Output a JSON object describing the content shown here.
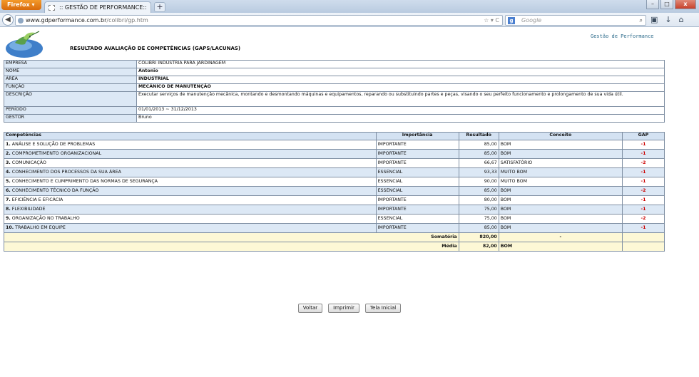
{
  "browser": {
    "app_button": "Firefox",
    "tab_title": ":: GESTÃO DE PERFORMANCE::",
    "new_tab": "+",
    "url_domain": "www.gdperformance.com.br",
    "url_path": "/colibri/gp.htm",
    "search_engine": "Google",
    "search_placeholder": "Google"
  },
  "page": {
    "report_title": "RESULTADO AVALIAÇÃO DE COMPETÊNCIAS (GAPS/LACUNAS)",
    "brand": "Gestão de Performance"
  },
  "info": {
    "empresa_label": "EMPRESA",
    "empresa": "COLIBRI INDÚSTRIA PARA JARDINAGEM",
    "nome_label": "NOME",
    "nome": "Antonio",
    "area_label": "ÁREA",
    "area": "INDUSTRIAL",
    "funcao_label": "FUNÇÃO",
    "funcao": "MECÂNICO DE MANUTENÇÃO",
    "descricao_label": "DESCRIÇÃO",
    "descricao": "Executar serviços de manutenção mecânica, montando e desmontando máquinas e equipamentos, reparando ou substituindo partes e peças, visando o seu perfeito funcionamento e prolongamento de sua vida útil.",
    "periodo_label": "PERÍODO",
    "periodo": "01/01/2013 ~ 31/12/2013",
    "gestor_label": "GESTOR",
    "gestor": "Bruno"
  },
  "competencias": {
    "headers": [
      "Competências",
      "Importância",
      "Resultado",
      "Conceito",
      "GAP"
    ],
    "rows": [
      {
        "num": "1.",
        "name": "ANÁLISE E SOLUÇÃO DE PROBLEMAS",
        "importancia": "IMPORTANTE",
        "resultado": "85,00",
        "conceito": "BOM",
        "gap": "-1"
      },
      {
        "num": "2.",
        "name": "COMPROMETIMENTO ORGANIZACIONAL",
        "importancia": "IMPORTANTE",
        "resultado": "85,00",
        "conceito": "BOM",
        "gap": "-1"
      },
      {
        "num": "3.",
        "name": "COMUNICAÇÃO",
        "importancia": "IMPORTANTE",
        "resultado": "66,67",
        "conceito": "SATISFATÓRIO",
        "gap": "-2"
      },
      {
        "num": "4.",
        "name": "CONHECIMENTO DOS PROCESSOS DA SUA ÁREA",
        "importancia": "ESSENCIAL",
        "resultado": "93,33",
        "conceito": "MUITO BOM",
        "gap": "-1"
      },
      {
        "num": "5.",
        "name": "CONHECIMENTO E CUMPRIMENTO DAS NORMAS DE SEGURANÇA",
        "importancia": "ESSENCIAL",
        "resultado": "90,00",
        "conceito": "MUITO BOM",
        "gap": "-1"
      },
      {
        "num": "6.",
        "name": "CONHECIMENTO TÉCNICO DA FUNÇÃO",
        "importancia": "ESSENCIAL",
        "resultado": "85,00",
        "conceito": "BOM",
        "gap": "-2"
      },
      {
        "num": "7.",
        "name": "EFICIÊNCIA E EFICÁCIA",
        "importancia": "IMPORTANTE",
        "resultado": "80,00",
        "conceito": "BOM",
        "gap": "-1"
      },
      {
        "num": "8.",
        "name": "FLEXIBILIDADE",
        "importancia": "IMPORTANTE",
        "resultado": "75,00",
        "conceito": "BOM",
        "gap": "-1"
      },
      {
        "num": "9.",
        "name": "ORGANIZAÇÃO NO TRABALHO",
        "importancia": "ESSENCIAL",
        "resultado": "75,00",
        "conceito": "BOM",
        "gap": "-2"
      },
      {
        "num": "10.",
        "name": "TRABALHO EM EQUIPE",
        "importancia": "IMPORTANTE",
        "resultado": "85,00",
        "conceito": "BOM",
        "gap": "-1"
      }
    ],
    "somatoria_label": "Somatória",
    "somatoria": "820,00",
    "somatoria_conceito": "-",
    "media_label": "Média",
    "media": "82,00",
    "media_conceito": "BOM"
  },
  "buttons": {
    "voltar": "Voltar",
    "imprimir": "Imprimir",
    "tela_inicial": "Tela Inicial"
  },
  "colors": {
    "row_alt": "#dce8f5",
    "header": "#d4e2f2",
    "total": "#fdf8d6",
    "gap": "#cc0000"
  }
}
